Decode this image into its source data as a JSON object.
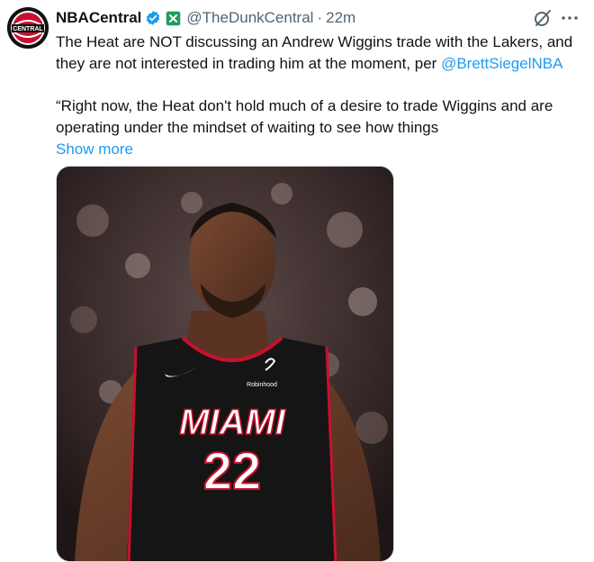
{
  "tweet": {
    "display_name": "NBACentral",
    "handle": "@TheDunkCentral",
    "separator": "·",
    "time": "22m",
    "text_line_1a": "The Heat are NOT discussing an Andrew Wiggins trade with the Lakers, and they are not interested in trading him at the moment, per ",
    "mention": "@BrettSiegelNBA",
    "text_line_2": "“Right now, the Heat don't hold much of a desire to trade Wiggins and are operating under the mindset of waiting to see how things",
    "show_more": "Show more",
    "avatar_text": "CENTRAL",
    "jersey_team": "MIAMI",
    "jersey_number": "22",
    "jersey_sponsor": "Robinhood"
  },
  "colors": {
    "link": "#1d9bf0",
    "verified": "#1d9bf0",
    "secondary_text": "#536471",
    "jersey": "#151515",
    "jersey_trim": "#c8102e"
  },
  "icons": {
    "verified": "verified-badge-icon",
    "affiliate": "affiliate-badge-icon",
    "grok": "grok-icon",
    "more": "more-options-icon"
  }
}
